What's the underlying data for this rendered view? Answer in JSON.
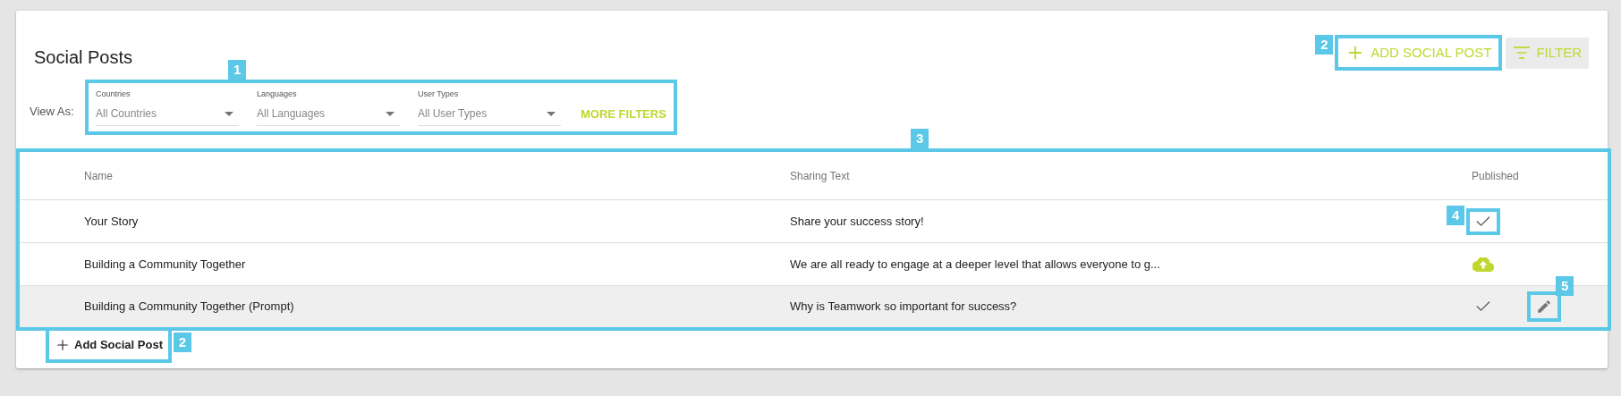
{
  "title": "Social Posts",
  "header_actions": [
    {
      "kind": "add",
      "label": "ADD SOCIAL POST",
      "callout": "2"
    },
    {
      "kind": "filter",
      "label": "FILTER"
    }
  ],
  "filters": {
    "label": "View As:",
    "callout": "1",
    "dropdowns": [
      {
        "label": "Countries",
        "value": "All Countries"
      },
      {
        "label": "Languages",
        "value": "All Languages"
      },
      {
        "label": "User Types",
        "value": "All User Types"
      }
    ],
    "more": "MORE FILTERS"
  },
  "table": {
    "callout": "3",
    "columns": [
      "Name",
      "Sharing Text",
      "Published"
    ],
    "rows": [
      {
        "name": "Your Story",
        "sharing_text": "Share your success story!",
        "published": true,
        "selected": false,
        "status_callout": "4"
      },
      {
        "name": "Building a Community Together",
        "sharing_text": "We are all ready to engage at a deeper level that allows everyone to g...",
        "published": false,
        "selected": false
      },
      {
        "name": "Building a Community Together (Prompt)",
        "sharing_text": "Why is Teamwork so important for success?",
        "published": true,
        "selected": true,
        "edit_callout": "5"
      }
    ]
  },
  "footer_button": {
    "label": "Add Social Post",
    "callout": "2"
  }
}
